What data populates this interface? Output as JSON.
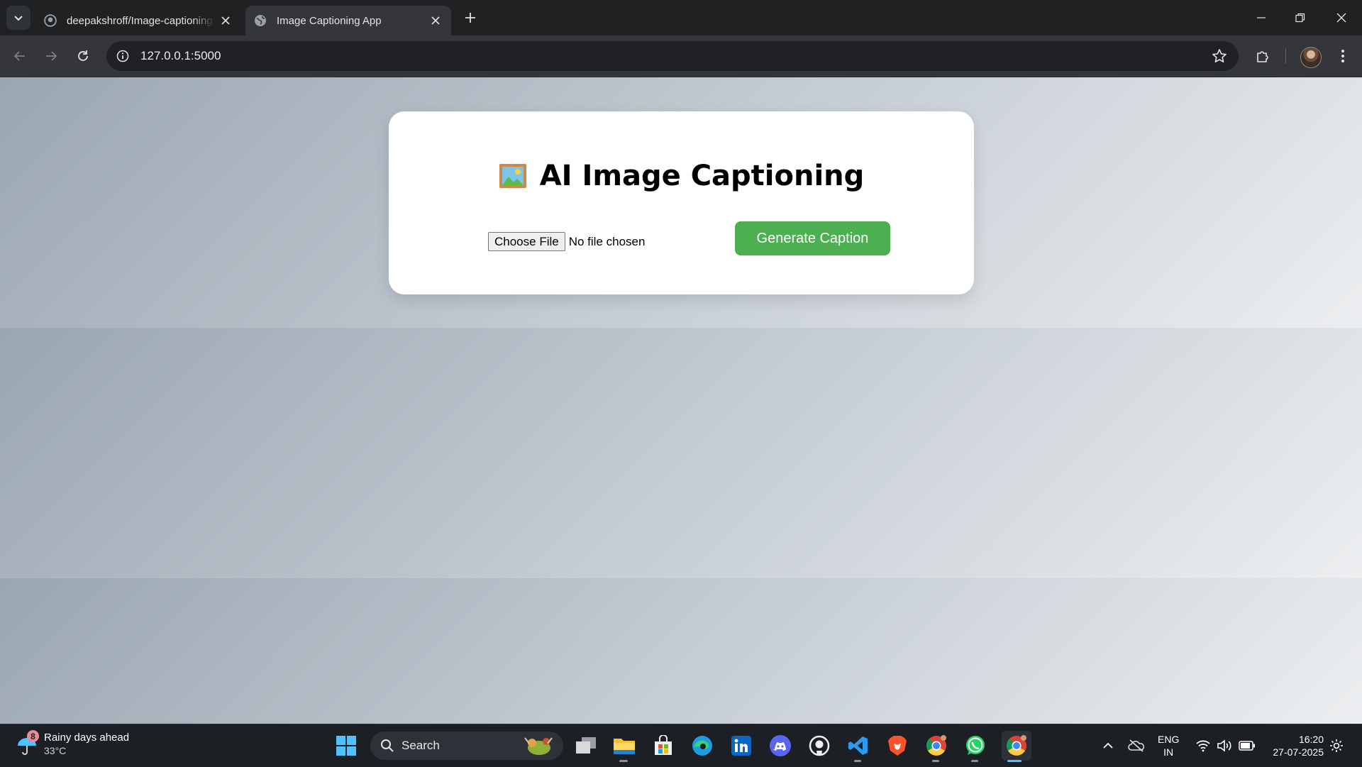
{
  "browser": {
    "tabs": [
      {
        "title": "deepakshroff/Image-captioning",
        "active": false
      },
      {
        "title": "Image Captioning App",
        "active": true
      }
    ],
    "url": "127.0.0.1:5000"
  },
  "page": {
    "title": "AI Image Captioning",
    "title_icon": "framed-picture-icon",
    "file_input": {
      "button_label": "Choose File",
      "status": "No file chosen"
    },
    "generate_button": "Generate Caption",
    "colors": {
      "accent": "#4caf50",
      "card": "#ffffff"
    }
  },
  "taskbar": {
    "weather": {
      "badge": "8",
      "text": "Rainy days ahead",
      "temp": "33°C"
    },
    "search_label": "Search",
    "apps": [
      "task-view",
      "file-explorer",
      "microsoft-store",
      "edge",
      "linkedin",
      "discord",
      "github",
      "vscode",
      "brave",
      "chrome",
      "whatsapp",
      "chrome-profile"
    ],
    "language": {
      "line1": "ENG",
      "line2": "IN"
    },
    "clock": {
      "time": "16:20",
      "date": "27-07-2025"
    }
  }
}
